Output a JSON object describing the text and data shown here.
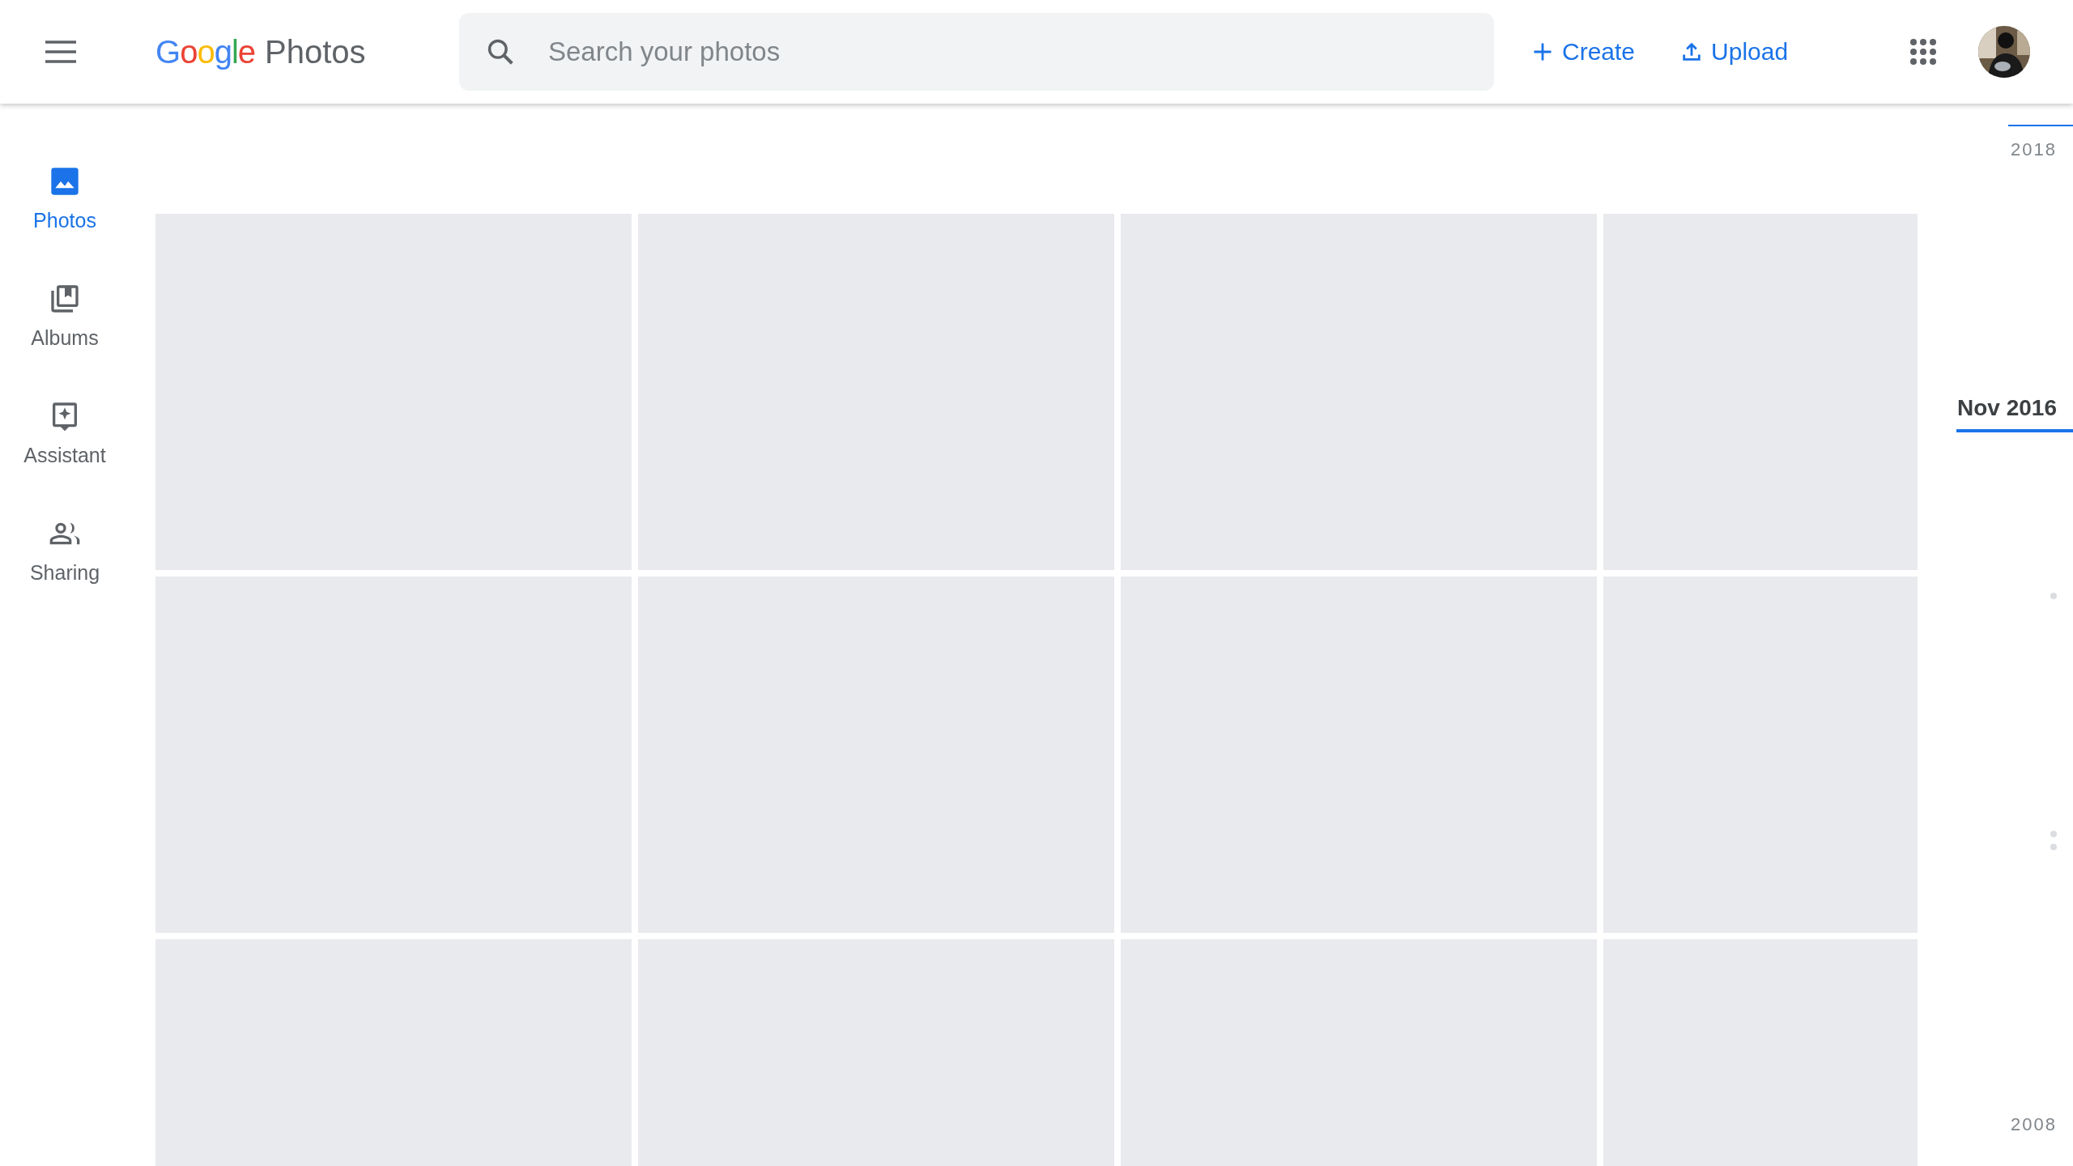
{
  "header": {
    "logo": {
      "letters": [
        {
          "char": "G",
          "color": "#4285f4"
        },
        {
          "char": "o",
          "color": "#ea4335"
        },
        {
          "char": "o",
          "color": "#fbbc05"
        },
        {
          "char": "g",
          "color": "#4285f4"
        },
        {
          "char": "l",
          "color": "#34a853"
        },
        {
          "char": "e",
          "color": "#ea4335"
        }
      ],
      "product": "Photos"
    },
    "search": {
      "placeholder": "Search your photos"
    },
    "actions": [
      {
        "kind": "create",
        "label": "Create"
      },
      {
        "kind": "upload",
        "label": "Upload"
      }
    ]
  },
  "sidebar": {
    "items": [
      {
        "kind": "photos",
        "label": "Photos",
        "selected": true
      },
      {
        "kind": "albums",
        "label": "Albums",
        "selected": false
      },
      {
        "kind": "assistant",
        "label": "Assistant",
        "selected": false
      },
      {
        "kind": "sharing",
        "label": "Sharing",
        "selected": false
      }
    ]
  },
  "grid": {
    "rows": [
      {
        "tiles": [
          {
            "kind": "placeholder"
          },
          {
            "kind": "placeholder"
          },
          {
            "kind": "placeholder"
          },
          {
            "kind": "placeholder"
          }
        ]
      },
      {
        "tiles": [
          {
            "kind": "placeholder"
          },
          {
            "kind": "placeholder"
          },
          {
            "kind": "placeholder"
          },
          {
            "kind": "placeholder"
          }
        ]
      },
      {
        "tiles": [
          {
            "kind": "placeholder"
          },
          {
            "kind": "placeholder"
          },
          {
            "kind": "placeholder"
          },
          {
            "kind": "placeholder"
          }
        ]
      }
    ]
  },
  "timeline": {
    "labels": [
      {
        "text": "2018",
        "selected": false
      },
      {
        "text": "Nov 2016",
        "selected": true
      },
      {
        "text": "2008",
        "selected": false
      }
    ]
  }
}
